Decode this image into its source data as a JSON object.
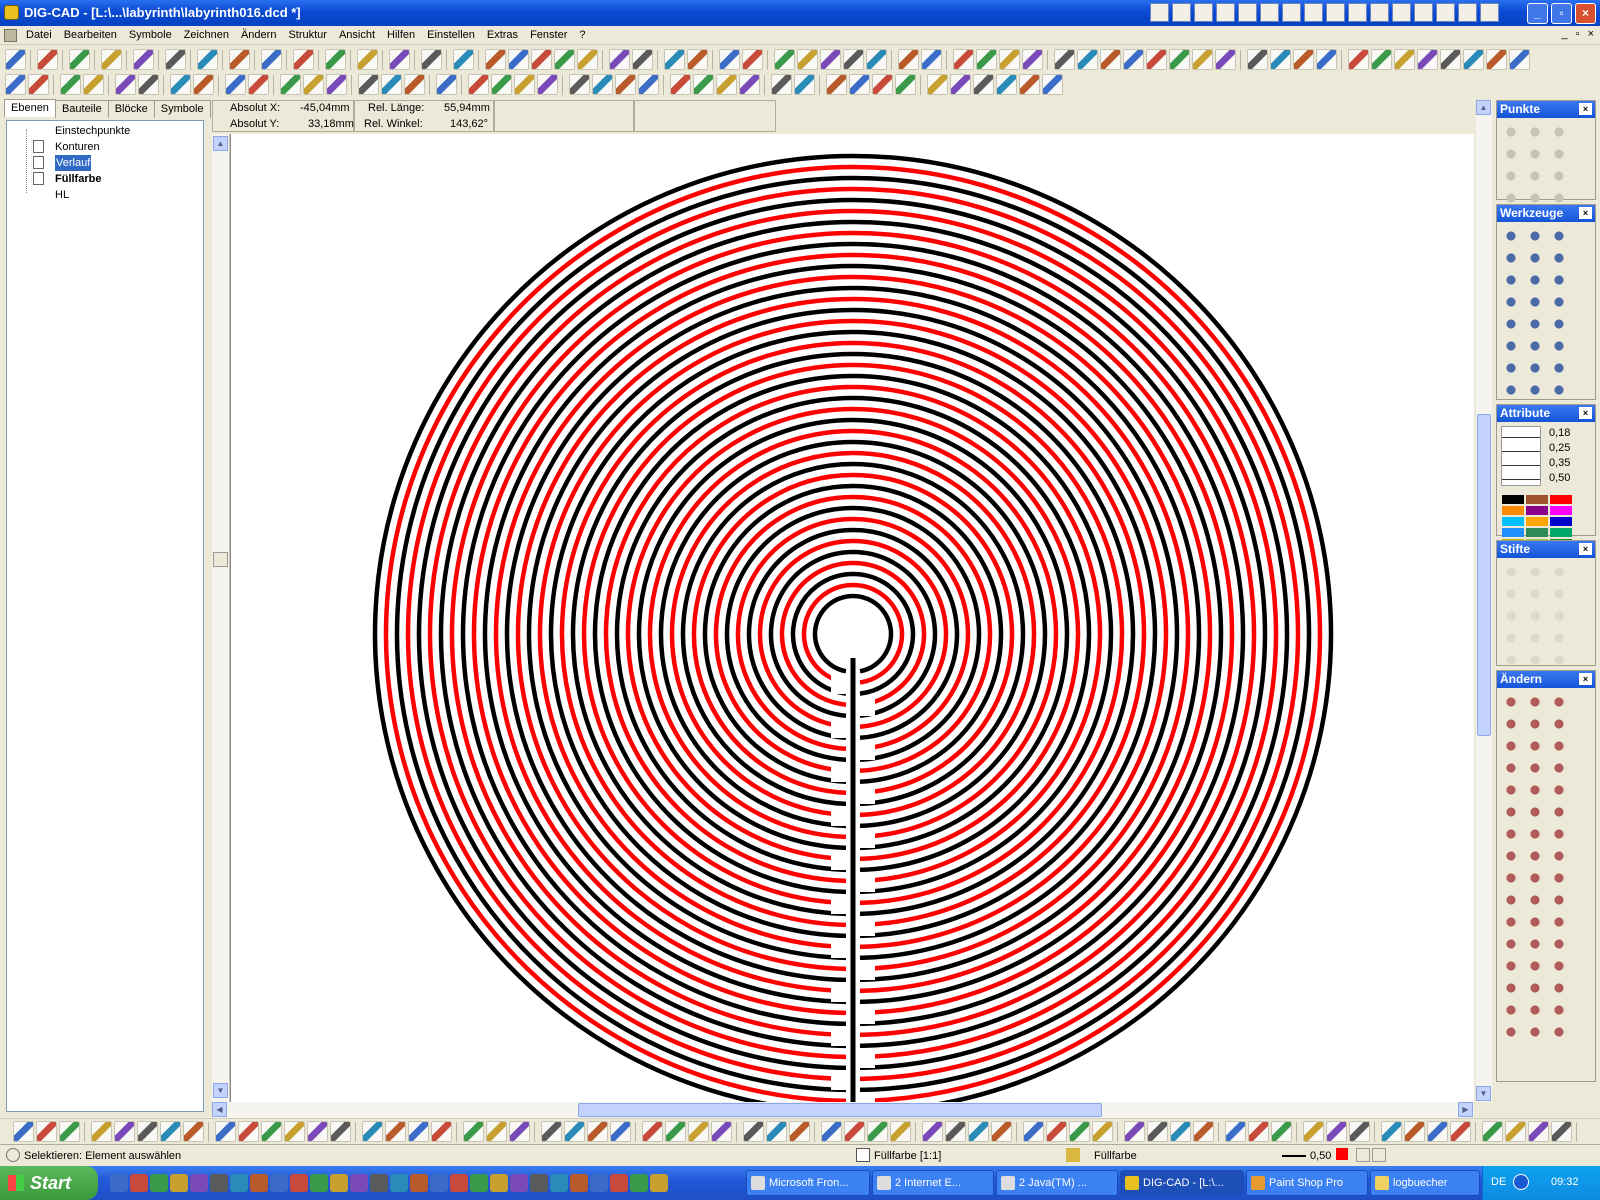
{
  "window": {
    "title": "DIG-CAD - [L:\\...\\labyrinth\\labyrinth016.dcd *]"
  },
  "menu": {
    "items": [
      "Datei",
      "Bearbeiten",
      "Symbole",
      "Zeichnen",
      "Ändern",
      "Struktur",
      "Ansicht",
      "Hilfen",
      "Einstellen",
      "Extras",
      "Fenster",
      "?"
    ],
    "mdi_buttons": [
      "_",
      "▫",
      "×"
    ]
  },
  "side": {
    "tabs": [
      "Ebenen",
      "Bauteile",
      "Blöcke",
      "Symbole"
    ],
    "layers": [
      {
        "label": "Einstechpunkte"
      },
      {
        "label": "Konturen"
      },
      {
        "label": "Verlauf"
      },
      {
        "label": "Füllfarbe"
      },
      {
        "label": "HL"
      }
    ]
  },
  "info": {
    "abs_x_label": "Absolut X:",
    "abs_x_value": "-45,04mm",
    "abs_y_label": "Absolut Y:",
    "abs_y_value": "33,18mm",
    "rel_len_label": "Rel. Länge:",
    "rel_len_value": "55,94mm",
    "rel_ang_label": "Rel. Winkel:",
    "rel_ang_value": "143,62°"
  },
  "panels": {
    "punkte": "Punkte",
    "werkzeuge": "Werkzeuge",
    "attribute": "Attribute",
    "stifte": "Stifte",
    "aendern": "Ändern",
    "line_widths": [
      "0,18",
      "0,25",
      "0,35",
      "0,50"
    ],
    "swatches": [
      "#000000",
      "#a0522d",
      "#ff0000",
      "#ff8c00",
      "#8b008b",
      "#ff00ff",
      "#00bfff",
      "#ffa500",
      "#0000cd",
      "#1e90ff",
      "#2e8b57",
      "#00a86b",
      "#b8b800",
      "#9acd32",
      "#228b22",
      "#3cb371"
    ]
  },
  "status": {
    "hint": "Selektieren: Element auswählen",
    "scale": "Füllfarbe [1:1]",
    "layer": "Füllfarbe",
    "pen_width": "0,50"
  },
  "taskbar": {
    "start": "Start",
    "tasks": [
      "Microsoft Fron...",
      "2 Internet E...",
      "2 Java(TM) ...",
      "DIG-CAD - [L:\\...",
      "Paint Shop Pro",
      "logbuecher"
    ],
    "lang": "DE",
    "time": "09:32"
  },
  "colors": {
    "maze_black": "#000000",
    "maze_red": "#ff0000"
  }
}
